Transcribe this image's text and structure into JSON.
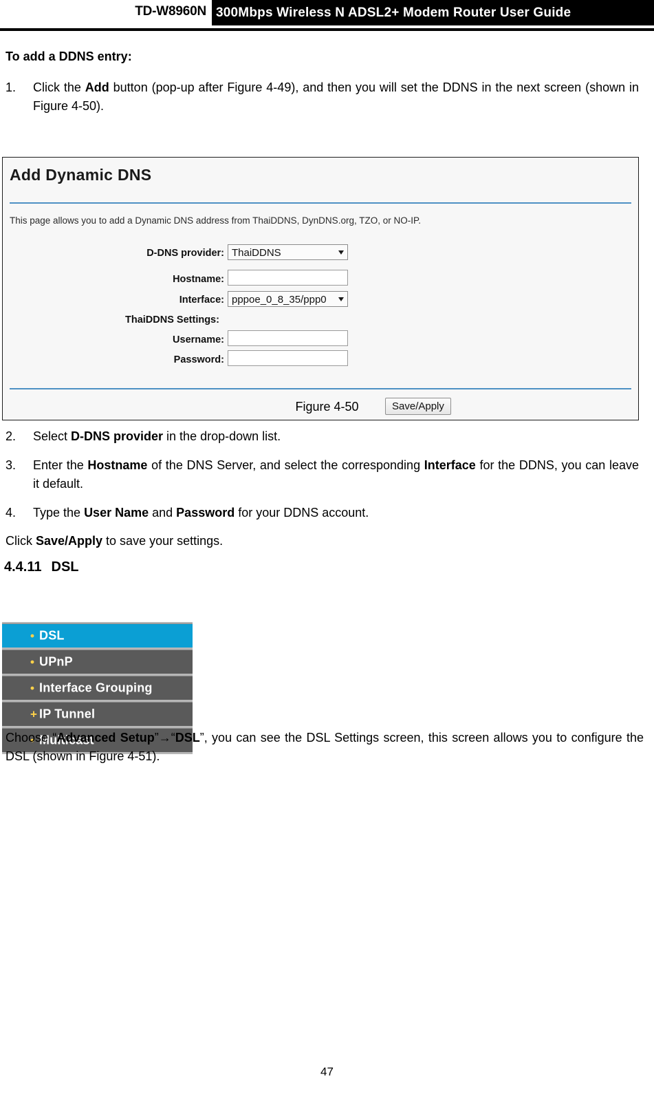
{
  "header": {
    "model": "TD-W8960N",
    "banner": "300Mbps Wireless N ADSL2+ Modem Router User Guide"
  },
  "section_intro": {
    "title": "To add a DDNS entry:"
  },
  "steps": [
    {
      "num": "1.",
      "parts": [
        {
          "t": "Click the ",
          "b": false
        },
        {
          "t": "Add",
          "b": true
        },
        {
          "t": " button (pop-up after Figure 4-49), and then you will set the DDNS in the next screen (shown in Figure 4-50).",
          "b": false
        }
      ]
    },
    {
      "num": "2.",
      "parts": [
        {
          "t": "Select ",
          "b": false
        },
        {
          "t": "D-DNS provider",
          "b": true
        },
        {
          "t": " in the drop-down list.",
          "b": false
        }
      ]
    },
    {
      "num": "3.",
      "parts": [
        {
          "t": "Enter the ",
          "b": false
        },
        {
          "t": "Hostname",
          "b": true
        },
        {
          "t": " of the DNS Server, and select the corresponding ",
          "b": false
        },
        {
          "t": "Interface",
          "b": true
        },
        {
          "t": " for the DDNS, you can leave it default.",
          "b": false
        }
      ]
    },
    {
      "num": "4.",
      "parts": [
        {
          "t": "Type the ",
          "b": false
        },
        {
          "t": "User Name",
          "b": true
        },
        {
          "t": " and ",
          "b": false
        },
        {
          "t": "Password",
          "b": true
        },
        {
          "t": " for your DDNS account.",
          "b": false
        }
      ]
    }
  ],
  "save_paragraph": [
    {
      "t": "Click ",
      "b": false
    },
    {
      "t": "Save/Apply",
      "b": true
    },
    {
      "t": " to save your settings.",
      "b": false
    }
  ],
  "dsl_heading": {
    "number": "4.4.11",
    "title": "DSL"
  },
  "closing_paragraph": [
    {
      "t": "Choose “",
      "b": false
    },
    {
      "t": "Advanced Setup",
      "b": true
    },
    {
      "t": "”→“",
      "b": false
    },
    {
      "t": "DSL",
      "b": true
    },
    {
      "t": "”, you can see the DSL Settings screen, this screen allows you to configure the DSL (shown in Figure 4-51).",
      "b": false
    }
  ],
  "figure_caption": "Figure 4-50",
  "router_ui": {
    "title": "Add Dynamic DNS",
    "description": "This page allows you to add a Dynamic DNS address from ThaiDDNS, DynDNS.org, TZO, or NO-IP.",
    "fields": {
      "provider_label": "D-DNS provider:",
      "provider_value": "ThaiDDNS",
      "hostname_label": "Hostname:",
      "hostname_value": "",
      "hostname_placeholder": "",
      "interface_label": "Interface:",
      "interface_value": "pppoe_0_8_35/ppp0",
      "settings_label": "ThaiDDNS Settings:",
      "username_label": "Username:",
      "username_value": "",
      "username_placeholder": "",
      "password_label": "Password:",
      "password_value": "",
      "password_placeholder": ""
    },
    "save_button": "Save/Apply",
    "colors": {
      "divider": "#4d90c4",
      "panel_bg": "#f7f7f7"
    }
  },
  "nav_menu": {
    "items": [
      {
        "label": "DSL",
        "marker": "•",
        "active": true
      },
      {
        "label": "UPnP",
        "marker": "•",
        "active": false
      },
      {
        "label": "Interface Grouping",
        "marker": "•",
        "active": false
      },
      {
        "label": "IP Tunnel",
        "marker": "+",
        "active": false
      },
      {
        "label": "Multicast",
        "marker": "•",
        "active": false
      }
    ],
    "colors": {
      "active_bg": "#0b9fd4",
      "item_bg": "#5a5a5a",
      "marker": "#ffd24a"
    }
  },
  "footer": {
    "page_number": "47"
  }
}
